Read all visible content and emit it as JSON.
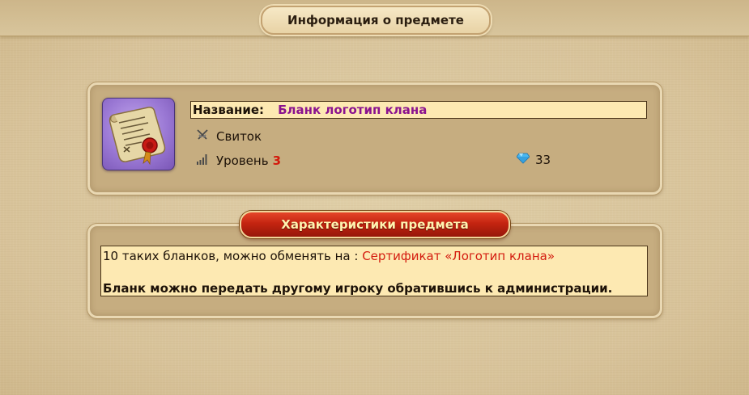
{
  "header": {
    "title": "Информация о предмете"
  },
  "item": {
    "icon": "scroll-with-seal-icon",
    "name_label": "Название:",
    "name_value": "Бланк логотип клана",
    "type_icon": "crossed-swords-icon",
    "type": "Свиток",
    "level_icon": "signal-bars-icon",
    "level_label": "Уровень",
    "level_value": "3",
    "price_icon": "diamond-icon",
    "price": "33"
  },
  "characteristics": {
    "title": "Характеристики предмета",
    "exchange_text": "10 таких бланков, можно обменять на :",
    "exchange_link": "Сертификат «Логотип клана»",
    "note": "Бланк можно передать другому игроку обратившись к администрации."
  },
  "colors": {
    "name_value": "#8b138f",
    "level_value": "#d31a0c",
    "link": "#d41c10",
    "ribbon": "#c42410",
    "field_background": "#fde9b2"
  }
}
